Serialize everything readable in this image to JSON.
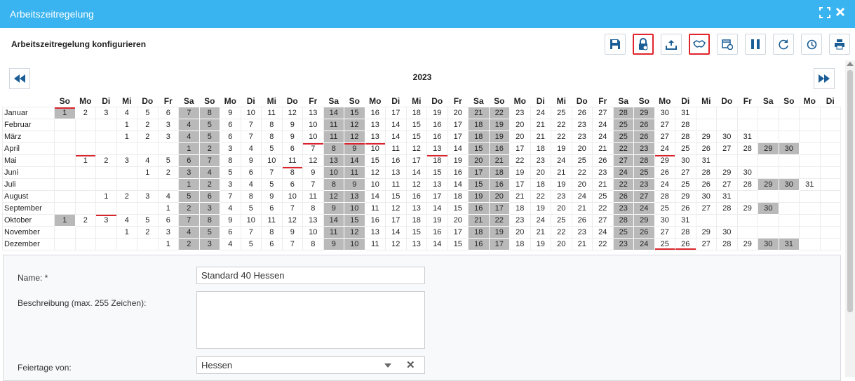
{
  "window": {
    "title": "Arbeitszeitregelung"
  },
  "header": {
    "section_title": "Arbeitszeitregelung konfigurieren"
  },
  "toolbar": [
    {
      "name": "save-button",
      "icon": "save-icon",
      "highlight": false
    },
    {
      "name": "lock-button",
      "icon": "lock-icon",
      "highlight": true
    },
    {
      "name": "upload-button",
      "icon": "upload-icon",
      "highlight": false
    },
    {
      "name": "handshake-button",
      "icon": "handshake-icon",
      "highlight": true
    },
    {
      "name": "calendar-settings-button",
      "icon": "calendar-gear-icon",
      "highlight": false
    },
    {
      "name": "pause-button",
      "icon": "pause-icon",
      "highlight": false
    },
    {
      "name": "redo-button",
      "icon": "redo-icon",
      "highlight": false
    },
    {
      "name": "history-button",
      "icon": "history-icon",
      "highlight": false
    },
    {
      "name": "print-button",
      "icon": "print-icon",
      "highlight": false
    }
  ],
  "calendar": {
    "year": "2023",
    "weekday_headers": [
      "So",
      "Mo",
      "Di",
      "Mi",
      "Do",
      "Fr",
      "Sa",
      "So",
      "Mo",
      "Di",
      "Mi",
      "Do",
      "Fr",
      "Sa",
      "So",
      "Mo",
      "Di",
      "Mi",
      "Do",
      "Fr",
      "Sa",
      "So",
      "Mo",
      "Di",
      "Mi",
      "Do",
      "Fr",
      "Sa",
      "So",
      "Mo",
      "Di",
      "Mi",
      "Do",
      "Fr",
      "Sa",
      "So",
      "Mo",
      "Di"
    ],
    "months": [
      {
        "name": "Januar",
        "offset": 0,
        "days": 31,
        "holidays": [
          1
        ]
      },
      {
        "name": "Februar",
        "offset": 3,
        "days": 28,
        "holidays": []
      },
      {
        "name": "März",
        "offset": 3,
        "days": 31,
        "holidays": []
      },
      {
        "name": "April",
        "offset": 6,
        "days": 30,
        "holidays": [
          7,
          9,
          10
        ]
      },
      {
        "name": "Mai",
        "offset": 1,
        "days": 31,
        "holidays": [
          1,
          18,
          29
        ]
      },
      {
        "name": "Juni",
        "offset": 4,
        "days": 30,
        "holidays": [
          8
        ]
      },
      {
        "name": "Juli",
        "offset": 6,
        "days": 31,
        "holidays": []
      },
      {
        "name": "August",
        "offset": 2,
        "days": 31,
        "holidays": []
      },
      {
        "name": "September",
        "offset": 5,
        "days": 30,
        "holidays": []
      },
      {
        "name": "Oktober",
        "offset": 0,
        "days": 31,
        "holidays": [
          3
        ]
      },
      {
        "name": "November",
        "offset": 3,
        "days": 30,
        "holidays": []
      },
      {
        "name": "Dezember",
        "offset": 5,
        "days": 31,
        "holidays_bottom": [
          25,
          26
        ],
        "holidays": []
      }
    ]
  },
  "form": {
    "name_label": "Name: *",
    "name_value": "Standard 40 Hessen",
    "description_label": "Beschreibung (max. 255 Zeichen):",
    "description_value": "",
    "holidays_label": "Feiertage von:",
    "holidays_value": "Hessen"
  },
  "colors": {
    "titlebar": "#3ab4f0",
    "weekend": "#b9b9b9",
    "holiday_marker": "#d9262c",
    "icon": "#1b5e96"
  }
}
